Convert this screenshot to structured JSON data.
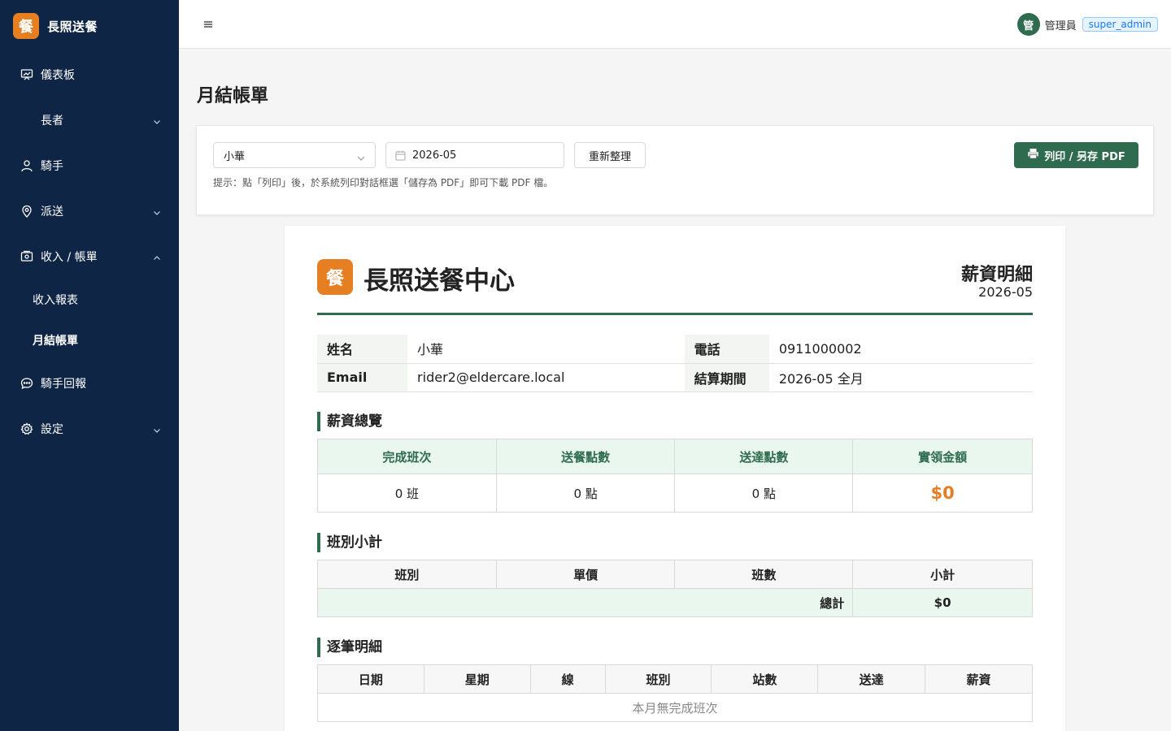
{
  "brand": {
    "logo_char": "餐",
    "name": "長照送餐"
  },
  "sidebar": {
    "items": [
      {
        "label": "儀表板",
        "icon": "dashboard-icon"
      },
      {
        "label": "長者",
        "icon": "none"
      },
      {
        "label": "騎手",
        "icon": "user-icon"
      },
      {
        "label": "派送",
        "icon": "location-icon"
      },
      {
        "label": "收入 / 帳單",
        "icon": "receipt-icon"
      },
      {
        "label": "騎手回報",
        "icon": "chat-icon"
      },
      {
        "label": "設定",
        "icon": "gear-icon"
      }
    ],
    "sub_items": [
      {
        "label": "收入報表"
      },
      {
        "label": "月結帳單"
      }
    ]
  },
  "header": {
    "avatar_char": "管",
    "user_name": "管理員",
    "role": "super_admin"
  },
  "page": {
    "title": "月結帳單"
  },
  "toolbar": {
    "rider_select": "小華",
    "month": "2026-05",
    "refresh_label": "重新整理",
    "print_label": "列印 / 另存 PDF",
    "hint": "提示：點「列印」後，於系統列印對話框選「儲存為 PDF」即可下載 PDF 檔。"
  },
  "document": {
    "logo_char": "餐",
    "org_name": "長照送餐中心",
    "doc_type": "薪資明細",
    "period": "2026-05",
    "info": {
      "name_label": "姓名",
      "name": "小華",
      "phone_label": "電話",
      "phone": "0911000002",
      "email_label": "Email",
      "email": "rider2@eldercare.local",
      "settle_label": "結算期間",
      "settle": "2026-05 全月"
    },
    "summary": {
      "title": "薪資總覽",
      "headers": [
        "完成班次",
        "送餐點數",
        "送達點數",
        "實領金額"
      ],
      "values": [
        "0 班",
        "0 點",
        "0 點",
        "$0"
      ]
    },
    "shift_subtotal": {
      "title": "班別小計",
      "headers": [
        "班別",
        "單價",
        "班數",
        "小計"
      ],
      "total_label": "總計",
      "total_value": "$0"
    },
    "detail": {
      "title": "逐筆明細",
      "headers": [
        "日期",
        "星期",
        "線",
        "班別",
        "站數",
        "送達",
        "薪資"
      ],
      "empty_text": "本月無完成班次"
    }
  },
  "colors": {
    "sidebar_bg": "#0e2545",
    "accent_green": "#2e6b4f",
    "brand_orange": "#e67e22"
  }
}
